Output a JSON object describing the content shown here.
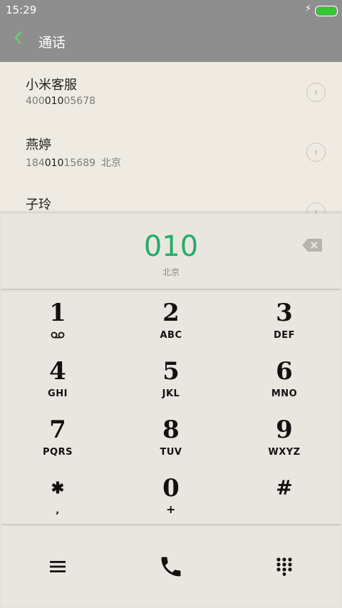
{
  "status": {
    "time": "15:29",
    "charging_icon": "bolt-icon",
    "battery_color": "#32c832"
  },
  "appbar": {
    "title": "通话",
    "back_icon": "chevron-left-icon",
    "accent": "#6bd36b"
  },
  "contacts": [
    {
      "name": "小米客服",
      "num_pre": "400",
      "num_match": "010",
      "num_post": "05678",
      "location": ""
    },
    {
      "name": "燕婷",
      "num_pre": "184",
      "num_match": "010",
      "num_post": "15689",
      "location": "北京"
    },
    {
      "name": "子玲",
      "num_pre": "",
      "num_match": "",
      "num_post": "",
      "location": ""
    }
  ],
  "dialer": {
    "number": "010",
    "location": "北京",
    "number_color": "#22ad6a",
    "keys": [
      {
        "digit": "1",
        "letters": ""
      },
      {
        "digit": "2",
        "letters": "ABC"
      },
      {
        "digit": "3",
        "letters": "DEF"
      },
      {
        "digit": "4",
        "letters": "GHI"
      },
      {
        "digit": "5",
        "letters": "JKL"
      },
      {
        "digit": "6",
        "letters": "MNO"
      },
      {
        "digit": "7",
        "letters": "PQRS"
      },
      {
        "digit": "8",
        "letters": "TUV"
      },
      {
        "digit": "9",
        "letters": "WXYZ"
      },
      {
        "digit": "✱",
        "letters": ","
      },
      {
        "digit": "0",
        "letters": "+"
      },
      {
        "digit": "#",
        "letters": ""
      }
    ]
  },
  "bottom": {
    "menu_icon": "menu-icon",
    "call_icon": "phone-icon",
    "keypad_icon": "keypad-icon"
  }
}
